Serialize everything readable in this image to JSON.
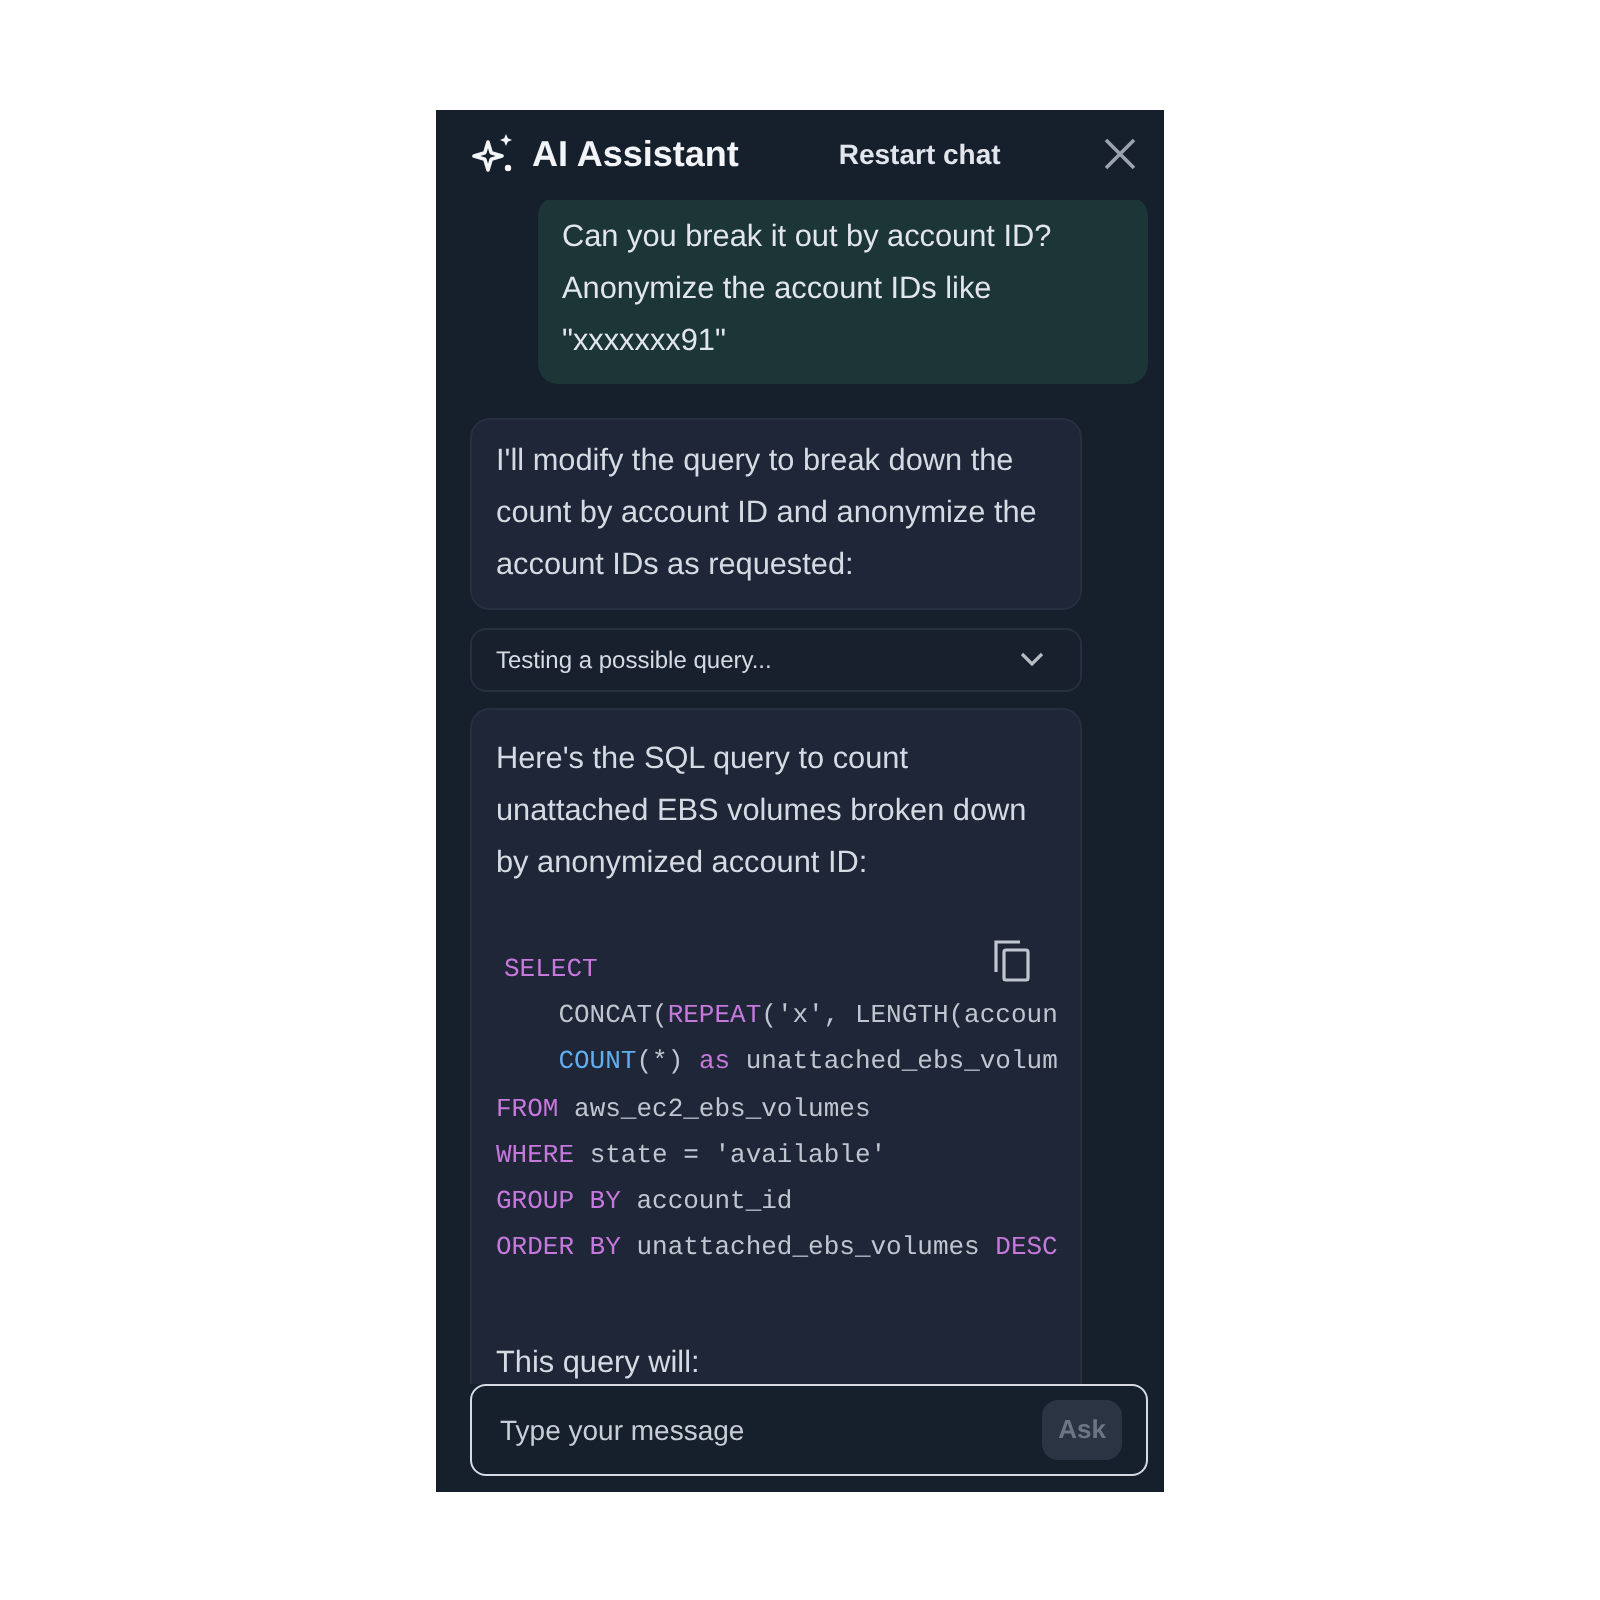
{
  "header": {
    "title": "AI Assistant",
    "restart": "Restart chat"
  },
  "messages": [
    {
      "kind": "user",
      "text": "Can you break it out by account ID? Anonymize the account IDs like \"xxxxxxx91\""
    },
    {
      "kind": "assistant",
      "text": "I'll modify the query to break down the count by account ID and anonymize the account IDs as requested:"
    },
    {
      "kind": "status",
      "text": "Testing a possible query...",
      "expanded": false
    },
    {
      "kind": "answer",
      "intro": "Here's the SQL query to count unattached EBS volumes broken down by anonymized account ID:",
      "code": [
        [
          {
            "kind": "keyword",
            "text": "SELECT"
          }
        ],
        [
          {
            "kind": "plain",
            "text": "    CONCAT("
          },
          {
            "kind": "keyword",
            "text": "REPEAT"
          },
          {
            "kind": "plain",
            "text": "('x', LENGTH(accoun"
          }
        ],
        [
          {
            "kind": "function",
            "text": "    COUNT"
          },
          {
            "kind": "plain",
            "text": "(*) "
          },
          {
            "kind": "keyword",
            "text": "as"
          },
          {
            "kind": "plain",
            "text": " unattached_ebs_volum"
          }
        ],
        [
          {
            "kind": "keyword",
            "text": "FROM"
          },
          {
            "kind": "plain",
            "text": " aws_ec2_ebs_volumes"
          }
        ],
        [
          {
            "kind": "keyword",
            "text": "WHERE"
          },
          {
            "kind": "plain",
            "text": " state = 'available'"
          }
        ],
        [
          {
            "kind": "keyword",
            "text": "GROUP BY"
          },
          {
            "kind": "plain",
            "text": " account_id"
          }
        ],
        [
          {
            "kind": "keyword",
            "text": "ORDER BY"
          },
          {
            "kind": "plain",
            "text": " unattached_ebs_volumes "
          },
          {
            "kind": "keyword",
            "text": "DESC"
          }
        ]
      ],
      "outro": "This query will:"
    }
  ],
  "input": {
    "placeholder": "Type your message",
    "button": "Ask",
    "disabled": true
  }
}
